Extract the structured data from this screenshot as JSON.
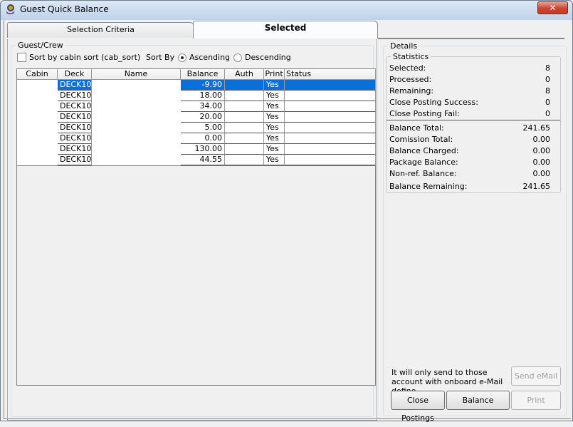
{
  "window": {
    "title": "Guest Quick Balance",
    "close_label": "✕"
  },
  "tabs": [
    {
      "label": "Selection Criteria",
      "active": false
    },
    {
      "label": "Selected",
      "active": true
    }
  ],
  "guest_crew": {
    "group_label": "Guest/Crew",
    "sort_cabin_label": "Sort by cabin sort (cab_sort)",
    "sort_cabin_checked": false,
    "sort_by_label": "Sort By",
    "ascending_label": "Ascending",
    "descending_label": "Descending",
    "sort_order": "Ascending"
  },
  "grid": {
    "columns": [
      "Cabin",
      "Deck",
      "Name",
      "Balance",
      "Auth",
      "Print",
      "Status"
    ],
    "rows": [
      {
        "cabin": "",
        "deck": "DECK10",
        "name": "",
        "balance": "-9.90",
        "auth": "",
        "print": "Yes",
        "status": "",
        "selected": true
      },
      {
        "cabin": "",
        "deck": "DECK10",
        "name": "",
        "balance": "18.00",
        "auth": "",
        "print": "Yes",
        "status": ""
      },
      {
        "cabin": "",
        "deck": "DECK10",
        "name": "",
        "balance": "34.00",
        "auth": "",
        "print": "Yes",
        "status": ""
      },
      {
        "cabin": "",
        "deck": "DECK10",
        "name": "",
        "balance": "20.00",
        "auth": "",
        "print": "Yes",
        "status": ""
      },
      {
        "cabin": "",
        "deck": "DECK10",
        "name": "",
        "balance": "5.00",
        "auth": "",
        "print": "Yes",
        "status": ""
      },
      {
        "cabin": "",
        "deck": "DECK10",
        "name": "",
        "balance": "0.00",
        "auth": "",
        "print": "Yes",
        "status": ""
      },
      {
        "cabin": "",
        "deck": "DECK10",
        "name": "",
        "balance": "130.00",
        "auth": "",
        "print": "Yes",
        "status": ""
      },
      {
        "cabin": "",
        "deck": "DECK10",
        "name": "",
        "balance": "44.55",
        "auth": "",
        "print": "Yes",
        "status": ""
      }
    ]
  },
  "details": {
    "group_label": "Details",
    "statistics_label": "Statistics",
    "stats": [
      {
        "label": "Selected:",
        "value": "8"
      },
      {
        "label": "Processed:",
        "value": "0"
      },
      {
        "label": "Remaining:",
        "value": "8"
      },
      {
        "label": "Close Posting Success:",
        "value": "0"
      },
      {
        "label": "Close Posting Fail:",
        "value": "0"
      }
    ],
    "totals": [
      {
        "label": "Balance Total:",
        "value": "241.65"
      },
      {
        "label": "Comission Total:",
        "value": "0.00"
      },
      {
        "label": "Balance Charged:",
        "value": "0.00"
      },
      {
        "label": "Package Balance:",
        "value": "0.00"
      },
      {
        "label": "Non-ref. Balance:",
        "value": "0.00"
      },
      {
        "label": "Balance Remaining:",
        "value": "241.65"
      }
    ],
    "email_note": "It will only send to those account with onboard e-Mail define",
    "buttons": {
      "send_email": "Send eMail",
      "close_postings": "Close Postings",
      "balance": "Balance",
      "print": "Print"
    }
  },
  "colors": {
    "selection": "#0a6fd6",
    "close_button": "#c9452d"
  }
}
